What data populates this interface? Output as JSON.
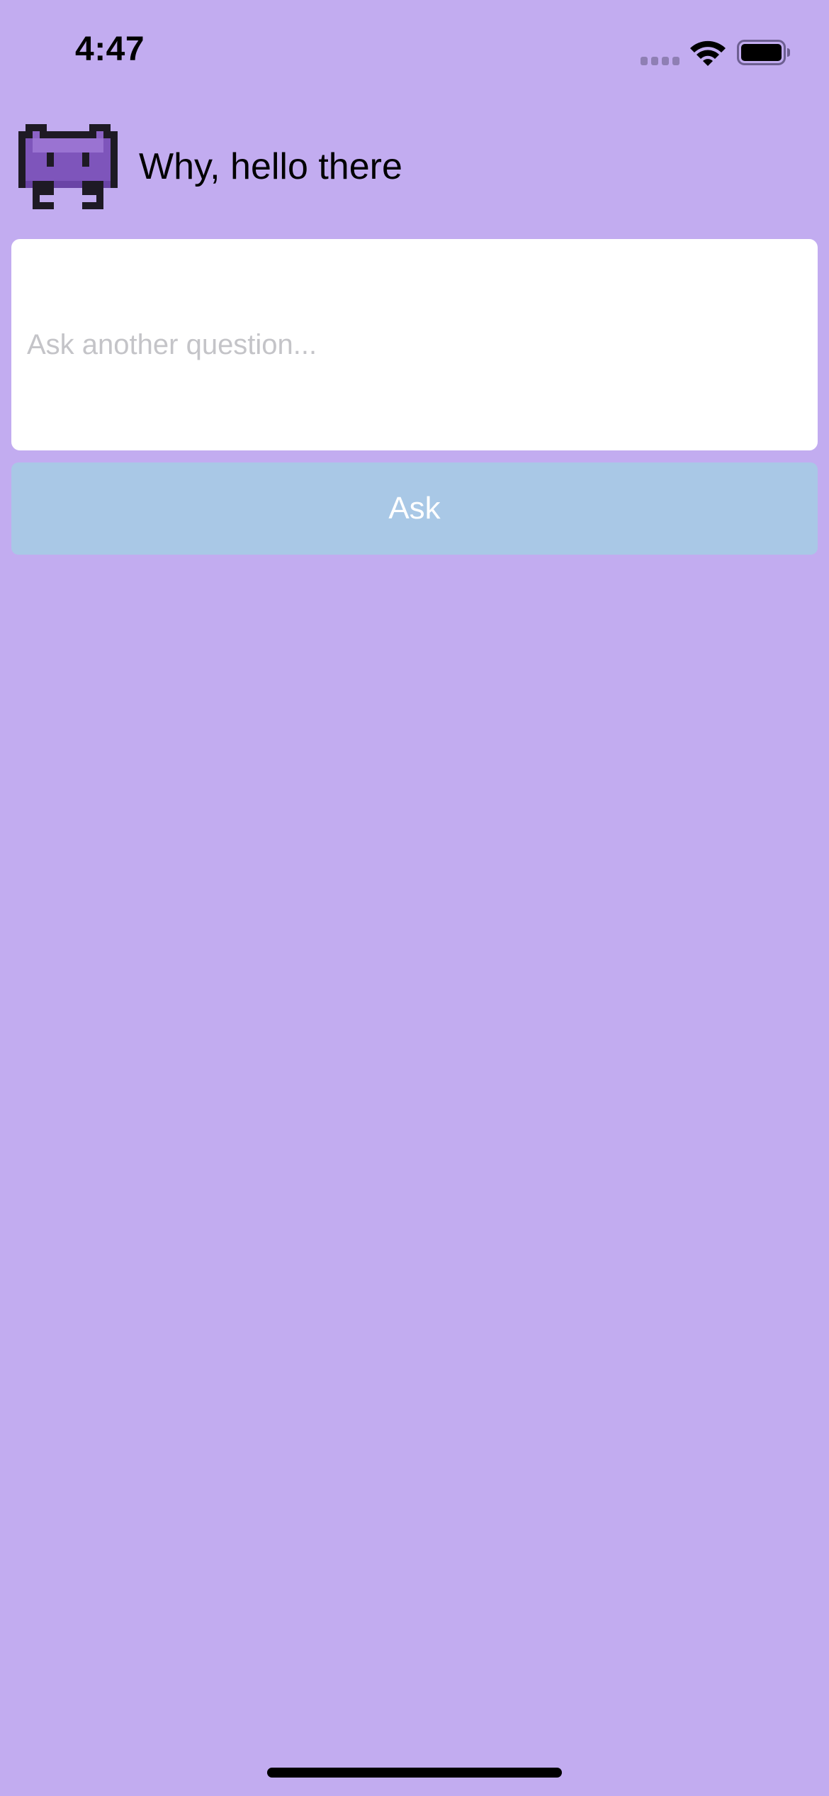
{
  "status_bar": {
    "time": "4:47",
    "signal_icon": "cellular-signal-icon",
    "wifi_icon": "wifi-icon",
    "battery_icon": "battery-icon",
    "battery_level": 1.0
  },
  "header": {
    "avatar_icon": "alien-monster-icon",
    "greeting": "Why, hello there"
  },
  "question": {
    "value": "",
    "placeholder": "Ask another question..."
  },
  "ask_button": {
    "label": "Ask"
  },
  "colors": {
    "background": "#c2acf0",
    "button": "#a9c8e6",
    "input_background": "#ffffff"
  }
}
